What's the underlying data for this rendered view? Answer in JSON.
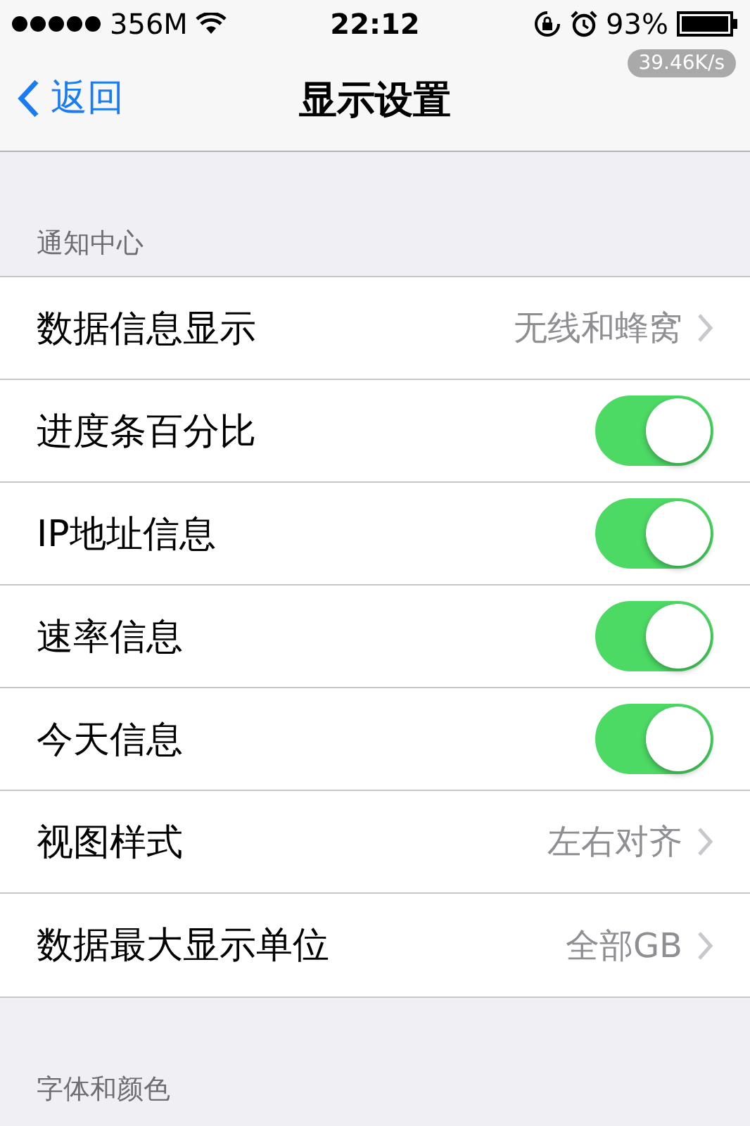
{
  "status_bar": {
    "carrier": "356M",
    "time": "22:12",
    "battery": "93%"
  },
  "speed_badge": "39.46K/s",
  "nav": {
    "back": "返回",
    "title": "显示设置"
  },
  "sections": [
    {
      "header": "通知中心",
      "rows": [
        {
          "kind": "value",
          "label": "数据信息显示",
          "value": "无线和蜂窝"
        },
        {
          "kind": "toggle",
          "label": "进度条百分比",
          "on": true
        },
        {
          "kind": "toggle",
          "label": "IP地址信息",
          "on": true
        },
        {
          "kind": "toggle",
          "label": "速率信息",
          "on": true
        },
        {
          "kind": "toggle",
          "label": "今天信息",
          "on": true
        },
        {
          "kind": "value",
          "label": "视图样式",
          "value": "左右对齐"
        },
        {
          "kind": "value",
          "label": "数据最大显示单位",
          "value": "全部GB"
        }
      ]
    },
    {
      "header": "字体和颜色"
    }
  ]
}
